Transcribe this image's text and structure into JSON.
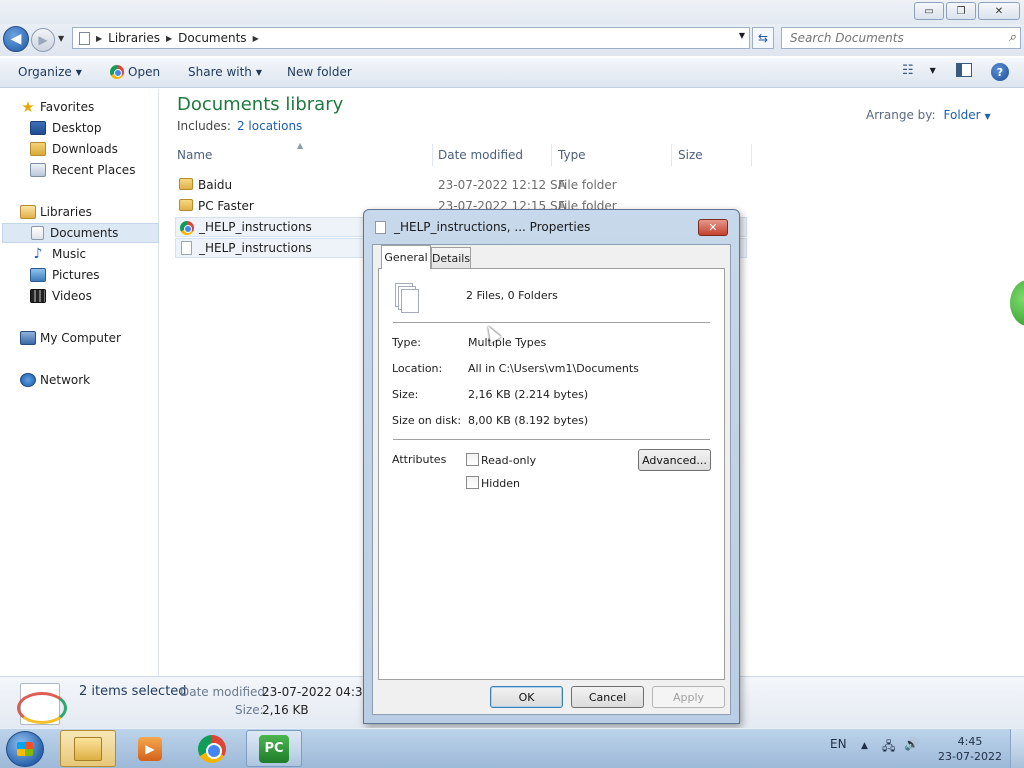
{
  "window": {
    "min": "▭",
    "max": "❐",
    "close": "✕"
  },
  "address": {
    "crumbs": [
      "Libraries",
      "Documents"
    ],
    "search_placeholder": "Search Documents"
  },
  "toolbar": {
    "organize": "Organize",
    "open": "Open",
    "share_with": "Share with",
    "new_folder": "New folder"
  },
  "sidebar": {
    "favorites": "Favorites",
    "desktop": "Desktop",
    "downloads": "Downloads",
    "recent_places": "Recent Places",
    "libraries": "Libraries",
    "documents": "Documents",
    "music": "Music",
    "pictures": "Pictures",
    "videos": "Videos",
    "my_computer": "My Computer",
    "network": "Network"
  },
  "library": {
    "title": "Documents library",
    "includes_label": "Includes:",
    "includes_link": "2 locations",
    "arrange_label": "Arrange by:",
    "arrange_value": "Folder"
  },
  "columns": {
    "name": "Name",
    "date": "Date modified",
    "type": "Type",
    "size": "Size"
  },
  "files": [
    {
      "name": "Baidu",
      "date": "23-07-2022 12:12 SA",
      "type": "File folder"
    },
    {
      "name": "PC Faster",
      "date": "23-07-2022 12:15 SA",
      "type": "File folder"
    },
    {
      "name": "_HELP_instructions",
      "date": "",
      "type": ""
    },
    {
      "name": "_HELP_instructions",
      "date": "",
      "type": ""
    }
  ],
  "details": {
    "selected": "2 items selected",
    "date_label": "Date modified:",
    "date_value": "23-07-2022 04:30 SA",
    "size_label": "Size:",
    "size_value": "2,16 KB"
  },
  "dialog": {
    "title": "_HELP_instructions, ... Properties",
    "tab_general": "General",
    "tab_details": "Details",
    "count": "2 Files, 0 Folders",
    "type_label": "Type:",
    "type_value": "Multiple Types",
    "location_label": "Location:",
    "location_value": "All in C:\\Users\\vm1\\Documents",
    "size_label": "Size:",
    "size_value": "2,16 KB (2.214 bytes)",
    "disk_label": "Size on disk:",
    "disk_value": "8,00 KB (8.192 bytes)",
    "attributes_label": "Attributes",
    "readonly_label": "Read-only",
    "hidden_label": "Hidden",
    "advanced_label": "Advanced...",
    "ok": "OK",
    "cancel": "Cancel",
    "apply": "Apply"
  },
  "taskbar": {
    "lang": "EN",
    "time": "4:45",
    "date": "23-07-2022",
    "pc_label": "PC"
  }
}
